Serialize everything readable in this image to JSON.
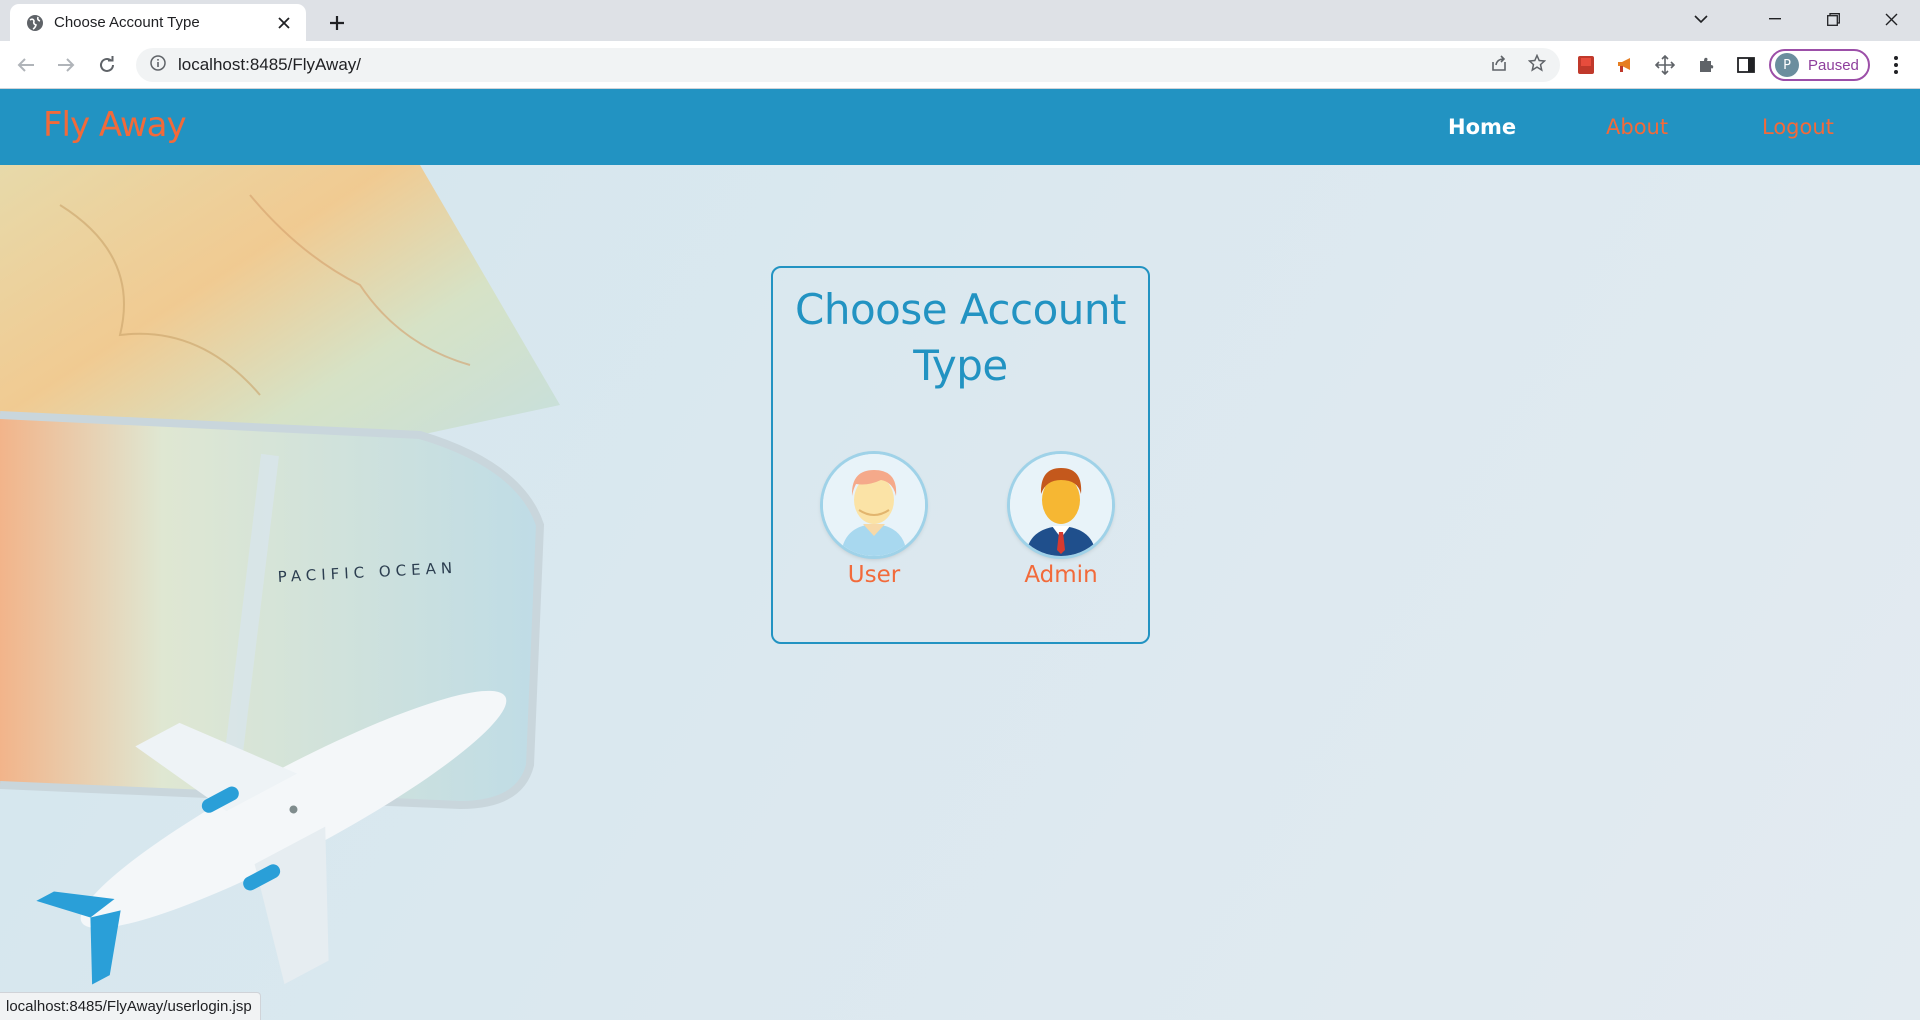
{
  "browser": {
    "tab_title": "Choose Account Type",
    "url": "localhost:8485/FlyAway/",
    "profile_initial": "P",
    "profile_status": "Paused",
    "status_url": "localhost:8485/FlyAway/userlogin.jsp"
  },
  "site": {
    "brand": "Fly Away",
    "nav": {
      "home": "Home",
      "about": "About",
      "logout": "Logout"
    }
  },
  "main": {
    "card_title": "Choose Account Type",
    "options": [
      {
        "label": "User",
        "icon": "user-avatar-icon"
      },
      {
        "label": "Admin",
        "icon": "admin-avatar-icon"
      }
    ]
  },
  "background": {
    "map_text": "PACIFIC OCEAN"
  },
  "colors": {
    "header_blue": "#2293c2",
    "accent_orange": "#f26a3a",
    "page_bg": "#dbe8ef"
  }
}
